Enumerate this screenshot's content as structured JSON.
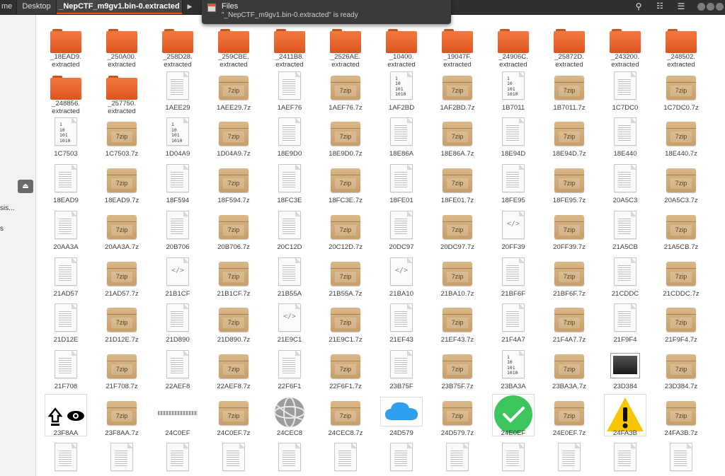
{
  "header": {
    "crumbs": [
      "me",
      "Desktop",
      "_NepCTF_m9gv1.bin-0.extracted"
    ],
    "arrow": "▶",
    "search_icon": "⚲",
    "view_icon": "☷",
    "menu_icon": "☰",
    "accent": "#e95420"
  },
  "notification": {
    "title": "Files",
    "body": "\"_NepCTF_m9gv1.bin-0.extracted\" is ready"
  },
  "sidebar": {
    "eject_icon": "⏏",
    "items": [
      "sis...",
      "s"
    ]
  },
  "files": [
    {
      "n1": "_18EAD9.",
      "n2": "extracted",
      "t": "folder"
    },
    {
      "n1": "_250A00.",
      "n2": "extracted",
      "t": "folder"
    },
    {
      "n1": "_258D28.",
      "n2": "extracted",
      "t": "folder"
    },
    {
      "n1": "_259CBE.",
      "n2": "extracted",
      "t": "folder"
    },
    {
      "n1": "_2411B8.",
      "n2": "extracted",
      "t": "folder"
    },
    {
      "n1": "_2526AE.",
      "n2": "extracted",
      "t": "folder"
    },
    {
      "n1": "_10400.",
      "n2": "extracted",
      "t": "folder"
    },
    {
      "n1": "_19047F.",
      "n2": "extracted",
      "t": "folder"
    },
    {
      "n1": "_24906C.",
      "n2": "extracted",
      "t": "folder"
    },
    {
      "n1": "_25872D.",
      "n2": "extracted",
      "t": "folder"
    },
    {
      "n1": "_243200.",
      "n2": "extracted",
      "t": "folder"
    },
    {
      "n1": "_248502.",
      "n2": "extracted",
      "t": "folder"
    },
    {
      "n1": "_248856.",
      "n2": "extracted",
      "t": "folder"
    },
    {
      "n1": "_257750.",
      "n2": "extracted",
      "t": "folder"
    },
    {
      "n1": "1AEE29",
      "t": "doc"
    },
    {
      "n1": "1AEE29.7z",
      "t": "7z"
    },
    {
      "n1": "1AEF76",
      "t": "doc"
    },
    {
      "n1": "1AEF76.7z",
      "t": "7z"
    },
    {
      "n1": "1AF2BD",
      "t": "bin"
    },
    {
      "n1": "1AF2BD.7z",
      "t": "7z"
    },
    {
      "n1": "1B7011",
      "t": "bin"
    },
    {
      "n1": "1B7011.7z",
      "t": "7z"
    },
    {
      "n1": "1C7DC0",
      "t": "doc"
    },
    {
      "n1": "1C7DC0.7z",
      "t": "7z"
    },
    {
      "n1": "1C7503",
      "t": "bin"
    },
    {
      "n1": "1C7503.7z",
      "t": "7z"
    },
    {
      "n1": "1D04A9",
      "t": "bin"
    },
    {
      "n1": "1D04A9.7z",
      "t": "7z"
    },
    {
      "n1": "18E9D0",
      "t": "doc"
    },
    {
      "n1": "18E9D0.7z",
      "t": "7z"
    },
    {
      "n1": "18E86A",
      "t": "doc"
    },
    {
      "n1": "18E86A.7z",
      "t": "7z"
    },
    {
      "n1": "18E94D",
      "t": "doc"
    },
    {
      "n1": "18E94D.7z",
      "t": "7z"
    },
    {
      "n1": "18E440",
      "t": "doc"
    },
    {
      "n1": "18E440.7z",
      "t": "7z"
    },
    {
      "n1": "18EAD9",
      "t": "doc"
    },
    {
      "n1": "18EAD9.7z",
      "t": "7z"
    },
    {
      "n1": "18F594",
      "t": "doc"
    },
    {
      "n1": "18F594.7z",
      "t": "7z"
    },
    {
      "n1": "18FC3E",
      "t": "doc"
    },
    {
      "n1": "18FC3E.7z",
      "t": "7z"
    },
    {
      "n1": "18FE01",
      "t": "doc"
    },
    {
      "n1": "18FE01.7z",
      "t": "7z"
    },
    {
      "n1": "18FE95",
      "t": "doc"
    },
    {
      "n1": "18FE95.7z",
      "t": "7z"
    },
    {
      "n1": "20A5C3",
      "t": "doc"
    },
    {
      "n1": "20A5C3.7z",
      "t": "7z"
    },
    {
      "n1": "20AA3A",
      "t": "doc"
    },
    {
      "n1": "20AA3A.7z",
      "t": "7z"
    },
    {
      "n1": "20B706",
      "t": "doc"
    },
    {
      "n1": "20B706.7z",
      "t": "7z"
    },
    {
      "n1": "20C12D",
      "t": "doc"
    },
    {
      "n1": "20C12D.7z",
      "t": "7z"
    },
    {
      "n1": "20DC97",
      "t": "doc"
    },
    {
      "n1": "20DC97.7z",
      "t": "7z"
    },
    {
      "n1": "20FF39",
      "t": "code"
    },
    {
      "n1": "20FF39.7z",
      "t": "7z"
    },
    {
      "n1": "21A5CB",
      "t": "doc"
    },
    {
      "n1": "21A5CB.7z",
      "t": "7z"
    },
    {
      "n1": "21AD57",
      "t": "doc"
    },
    {
      "n1": "21AD57.7z",
      "t": "7z"
    },
    {
      "n1": "21B1CF",
      "t": "code"
    },
    {
      "n1": "21B1CF.7z",
      "t": "7z"
    },
    {
      "n1": "21B55A",
      "t": "doc"
    },
    {
      "n1": "21B55A.7z",
      "t": "7z"
    },
    {
      "n1": "21BA10",
      "t": "code"
    },
    {
      "n1": "21BA10.7z",
      "t": "7z"
    },
    {
      "n1": "21BF6F",
      "t": "doc"
    },
    {
      "n1": "21BF6F.7z",
      "t": "7z"
    },
    {
      "n1": "21CDDC",
      "t": "doc"
    },
    {
      "n1": "21CDDC.7z",
      "t": "7z"
    },
    {
      "n1": "21D12E",
      "t": "doc"
    },
    {
      "n1": "21D12E.7z",
      "t": "7z"
    },
    {
      "n1": "21D890",
      "t": "doc"
    },
    {
      "n1": "21D890.7z",
      "t": "7z"
    },
    {
      "n1": "21E9C1",
      "t": "code"
    },
    {
      "n1": "21E9C1.7z",
      "t": "7z"
    },
    {
      "n1": "21EF43",
      "t": "doc"
    },
    {
      "n1": "21EF43.7z",
      "t": "7z"
    },
    {
      "n1": "21F4A7",
      "t": "doc"
    },
    {
      "n1": "21F4A7.7z",
      "t": "7z"
    },
    {
      "n1": "21F9F4",
      "t": "doc"
    },
    {
      "n1": "21F9F4.7z",
      "t": "7z"
    },
    {
      "n1": "21F708",
      "t": "doc"
    },
    {
      "n1": "21F708.7z",
      "t": "7z"
    },
    {
      "n1": "22AEF8",
      "t": "doc"
    },
    {
      "n1": "22AEF8.7z",
      "t": "7z"
    },
    {
      "n1": "22F6F1",
      "t": "doc"
    },
    {
      "n1": "22F6F1.7z",
      "t": "7z"
    },
    {
      "n1": "23B75F",
      "t": "doc"
    },
    {
      "n1": "23B75F.7z",
      "t": "7z"
    },
    {
      "n1": "23BA3A",
      "t": "bin"
    },
    {
      "n1": "23BA3A.7z",
      "t": "7z"
    },
    {
      "n1": "23D384",
      "t": "screen"
    },
    {
      "n1": "23D384.7z",
      "t": "7z"
    },
    {
      "n1": "23F8AA",
      "t": "upeye"
    },
    {
      "n1": "23F8AA.7z",
      "t": "7z"
    },
    {
      "n1": "24C0EF",
      "t": "strip"
    },
    {
      "n1": "24C0EF.7z",
      "t": "7z"
    },
    {
      "n1": "24CEC8",
      "t": "globe"
    },
    {
      "n1": "24CEC8.7z",
      "t": "7z"
    },
    {
      "n1": "24D579",
      "t": "cloud"
    },
    {
      "n1": "24D579.7z",
      "t": "7z"
    },
    {
      "n1": "24E0EF",
      "t": "check"
    },
    {
      "n1": "24E0EF.7z",
      "t": "7z"
    },
    {
      "n1": "24FA3B",
      "t": "warn"
    },
    {
      "n1": "24FA3B.7z",
      "t": "7z"
    },
    {
      "n1": "",
      "t": "doc"
    },
    {
      "n1": "",
      "t": "doc"
    },
    {
      "n1": "",
      "t": "doc"
    },
    {
      "n1": "",
      "t": "doc"
    },
    {
      "n1": "",
      "t": "doc"
    },
    {
      "n1": "",
      "t": "doc"
    },
    {
      "n1": "",
      "t": "doc"
    },
    {
      "n1": "",
      "t": "doc"
    },
    {
      "n1": "",
      "t": "doc"
    },
    {
      "n1": "",
      "t": "doc"
    },
    {
      "n1": "",
      "t": "doc"
    },
    {
      "n1": "",
      "t": "doc"
    }
  ],
  "icon_labels": {
    "zip": "7zip",
    "bin": "1\n10\n101\n1010",
    "code": "</>"
  }
}
